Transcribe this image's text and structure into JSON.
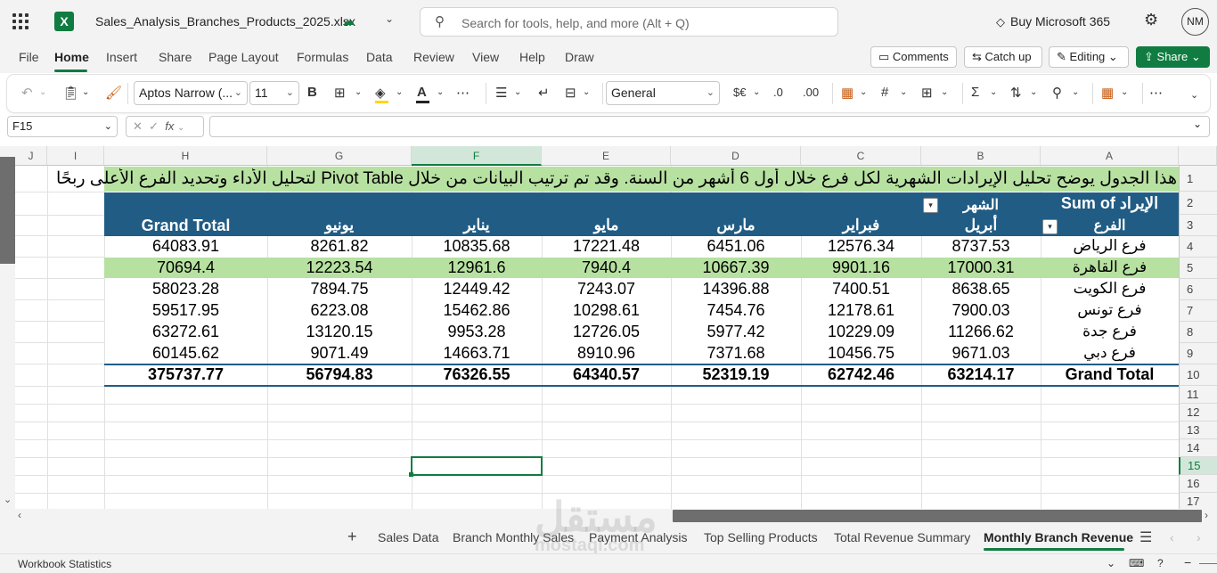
{
  "titlebar": {
    "filename": "Sales_Analysis_Branches_Products_2025.xlsx",
    "search_placeholder": "Search for tools, help, and more (Alt + Q)",
    "buy_label": "Buy Microsoft 365",
    "avatar_initials": "NM",
    "app_icon": "X"
  },
  "menu": {
    "items": [
      "File",
      "Home",
      "Insert",
      "Share",
      "Page Layout",
      "Formulas",
      "Data",
      "Review",
      "View",
      "Help",
      "Draw"
    ],
    "active": "Home",
    "comments": "Comments",
    "catch_up": "Catch up",
    "editing": "Editing",
    "share": "Share"
  },
  "ribbon": {
    "font_name": "Aptos Narrow (...",
    "font_size": "11",
    "number_format": "General",
    "currency_symbol": "$€",
    "decimal_increase": ".0",
    "decimal_decrease": ".00",
    "bold": "B"
  },
  "formula_bar": {
    "name_box": "F15",
    "fx": "fx",
    "content": ""
  },
  "columns": [
    "J",
    "I",
    "H",
    "G",
    "F",
    "E",
    "D",
    "C",
    "B",
    "A"
  ],
  "selected_column": "F",
  "rows": [
    "1",
    "2",
    "3",
    "4",
    "5",
    "6",
    "7",
    "8",
    "9",
    "10",
    "11",
    "12",
    "13",
    "14",
    "15",
    "16",
    "17"
  ],
  "selected_row": "15",
  "sheet": {
    "banner": "هذا الجدول يوضح تحليل الإيرادات الشهرية لكل فرع خلال أول 6 أشهر من السنة. وقد تم ترتيب البيانات من خلال Pivot Table لتحليل الأداء وتحديد الفرع الأعلى ربحًا",
    "pivot_value_label": "Sum of الإيراد",
    "month_field": "الشهر",
    "branch_field": "الفرع",
    "months": [
      "أبريل",
      "فبراير",
      "مارس",
      "مايو",
      "يناير",
      "يونيو"
    ],
    "grand_total_label": "Grand Total",
    "rows": [
      {
        "branch": "فرع الرياض",
        "values": [
          "8737.53",
          "12576.34",
          "6451.06",
          "17221.48",
          "10835.68",
          "8261.82"
        ],
        "total": "64083.91",
        "highlight": false
      },
      {
        "branch": "فرع القاهرة",
        "values": [
          "17000.31",
          "9901.16",
          "10667.39",
          "7940.4",
          "12961.6",
          "12223.54"
        ],
        "total": "70694.4",
        "highlight": true
      },
      {
        "branch": "فرع الكويت",
        "values": [
          "8638.65",
          "7400.51",
          "14396.88",
          "7243.07",
          "12449.42",
          "7894.75"
        ],
        "total": "58023.28",
        "highlight": false
      },
      {
        "branch": "فرع تونس",
        "values": [
          "7900.03",
          "12178.61",
          "7454.76",
          "10298.61",
          "15462.86",
          "6223.08"
        ],
        "total": "59517.95",
        "highlight": false
      },
      {
        "branch": "فرع جدة",
        "values": [
          "11266.62",
          "10229.09",
          "5977.42",
          "12726.05",
          "9953.28",
          "13120.15"
        ],
        "total": "63272.61",
        "highlight": false
      },
      {
        "branch": "فرع دبي",
        "values": [
          "9671.03",
          "10456.75",
          "7371.68",
          "8910.96",
          "14663.71",
          "9071.49"
        ],
        "total": "60145.62",
        "highlight": false
      }
    ],
    "grand_totals": [
      "63214.17",
      "62742.46",
      "52319.19",
      "64340.57",
      "76326.55",
      "56794.83"
    ],
    "grand_total_all": "375737.77"
  },
  "tabs": [
    "Sales Data",
    "Branch Monthly Sales",
    "Payment Analysis",
    "Top Selling Products",
    "Total Revenue Summary",
    "Monthly Branch Revenue"
  ],
  "active_tab": "Monthly Branch Revenue",
  "status": {
    "workbook_statistics": "Workbook Statistics"
  },
  "watermark": {
    "arabic": "مستقل",
    "latin": "mostaql.com"
  },
  "colors": {
    "excel_green": "#107c41",
    "header_blue": "#215c84",
    "banner_green": "#b7e1a1",
    "row_highlight": "#b7e1a1"
  }
}
